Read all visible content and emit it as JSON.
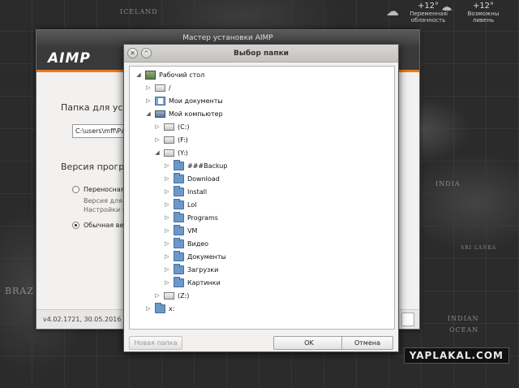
{
  "desktop": {
    "weather": [
      {
        "temp": "+12°",
        "desc1": "Переменная",
        "desc2": "облачность"
      },
      {
        "temp": "+12°",
        "desc1": "Возможны",
        "desc2": "ливень"
      }
    ],
    "map_labels": [
      "ICELAND",
      "INDIA",
      "SRI LANKA",
      "BRAZ",
      "INDIAN",
      "OCEAN"
    ],
    "watermark": "YAPLAKAL.COM"
  },
  "installer": {
    "title": "Мастер установки AIMP",
    "logo": "AIMP",
    "folder_heading": "Папка для уста",
    "folder_path": "C:\\users\\mff\\Раб",
    "version_heading": "Версия програм",
    "option_portable": "Переносная",
    "portable_sub1": "Версия для у",
    "portable_sub2": "Настройки хр",
    "option_normal": "Обычная вер",
    "footer": "v4.02.1721, 30.05.2016"
  },
  "dialog": {
    "title": "Выбор папки",
    "close_glyph": "✕",
    "up_glyph": "^",
    "tree": [
      {
        "label": "Рабочий стол",
        "exp": "◢",
        "icon": "desktop-icon"
      },
      {
        "label": "/",
        "exp": "▷",
        "icon": "drive-icon"
      },
      {
        "label": "Мои документы",
        "exp": "▷",
        "icon": "documents-icon"
      },
      {
        "label": "Мой компьютер",
        "exp": "◢",
        "icon": "computer-icon"
      },
      {
        "label": "(C:)",
        "exp": "▷",
        "icon": "drive-icon"
      },
      {
        "label": "(F:)",
        "exp": "▷",
        "icon": "drive-icon"
      },
      {
        "label": "(Y:)",
        "exp": "◢",
        "icon": "drive-icon"
      },
      {
        "label": "###Backup",
        "exp": "▷",
        "icon": "folder-icon"
      },
      {
        "label": "Download",
        "exp": "▷",
        "icon": "folder-icon"
      },
      {
        "label": "Install",
        "exp": "▷",
        "icon": "folder-icon"
      },
      {
        "label": "Lol",
        "exp": "▷",
        "icon": "folder-icon"
      },
      {
        "label": "Programs",
        "exp": "▷",
        "icon": "folder-icon"
      },
      {
        "label": "VM",
        "exp": "▷",
        "icon": "folder-icon"
      },
      {
        "label": "Видео",
        "exp": "▷",
        "icon": "folder-icon"
      },
      {
        "label": "Документы",
        "exp": "▷",
        "icon": "folder-icon"
      },
      {
        "label": "Загрузки",
        "exp": "▷",
        "icon": "folder-icon"
      },
      {
        "label": "Картинки",
        "exp": "▷",
        "icon": "folder-icon"
      },
      {
        "label": "(Z:)",
        "exp": "▷",
        "icon": "drive-icon"
      },
      {
        "label": "x:",
        "exp": "▷",
        "icon": "folder-icon"
      }
    ],
    "new_folder": "Новая папка",
    "ok": "OK",
    "cancel": "Отмена"
  },
  "colors": {
    "accent": "#e87b1c",
    "folder": "#6b97c9"
  }
}
